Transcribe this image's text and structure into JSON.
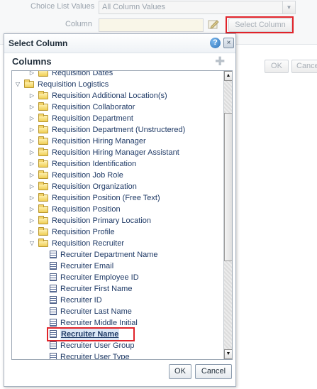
{
  "background": {
    "choice_list_label": "Choice List Values",
    "choice_list_value": "All Column Values",
    "column_label": "Column",
    "select_column_button": "Select Column",
    "ok_button": "OK",
    "cancel_button": "Cance"
  },
  "dialog": {
    "title": "Select Column",
    "help_icon": "?",
    "close_icon": "×",
    "columns_header": "Columns",
    "tree": [
      {
        "label": "Requisition Dates",
        "kind": "folder",
        "level": 1,
        "expanded": false
      },
      {
        "label": "Requisition Logistics",
        "kind": "folder",
        "level": 0,
        "expanded": true
      },
      {
        "label": "Requisition Additional Location(s)",
        "kind": "folder",
        "level": 1,
        "expanded": false
      },
      {
        "label": "Requisition Collaborator",
        "kind": "folder",
        "level": 1,
        "expanded": false
      },
      {
        "label": "Requisition Department",
        "kind": "folder",
        "level": 1,
        "expanded": false
      },
      {
        "label": "Requisition Department (Unstructered)",
        "kind": "folder",
        "level": 1,
        "expanded": false
      },
      {
        "label": "Requisition Hiring Manager",
        "kind": "folder",
        "level": 1,
        "expanded": false
      },
      {
        "label": "Requisition Hiring Manager Assistant",
        "kind": "folder",
        "level": 1,
        "expanded": false
      },
      {
        "label": "Requisition Identification",
        "kind": "folder",
        "level": 1,
        "expanded": false
      },
      {
        "label": "Requisition Job Role",
        "kind": "folder",
        "level": 1,
        "expanded": false
      },
      {
        "label": "Requisition Organization",
        "kind": "folder",
        "level": 1,
        "expanded": false
      },
      {
        "label": "Requisition Position (Free Text)",
        "kind": "folder",
        "level": 1,
        "expanded": false
      },
      {
        "label": "Requisition Position",
        "kind": "folder",
        "level": 1,
        "expanded": false
      },
      {
        "label": "Requisition Primary Location",
        "kind": "folder",
        "level": 1,
        "expanded": false
      },
      {
        "label": "Requisition Profile",
        "kind": "folder",
        "level": 1,
        "expanded": false
      },
      {
        "label": "Requisition Recruiter",
        "kind": "folder",
        "level": 1,
        "expanded": true
      },
      {
        "label": "Recruiter Department Name",
        "kind": "column",
        "level": 2
      },
      {
        "label": "Recruiter Email",
        "kind": "column",
        "level": 2
      },
      {
        "label": "Recruiter Employee ID",
        "kind": "column",
        "level": 2
      },
      {
        "label": "Recruiter First Name",
        "kind": "column",
        "level": 2
      },
      {
        "label": "Recruiter ID",
        "kind": "column",
        "level": 2
      },
      {
        "label": "Recruiter Last Name",
        "kind": "column",
        "level": 2
      },
      {
        "label": "Recruiter Middle Initial",
        "kind": "column",
        "level": 2
      },
      {
        "label": "Recruiter Name",
        "kind": "column",
        "level": 2,
        "selected": true
      },
      {
        "label": "Recruiter User Group",
        "kind": "column",
        "level": 2
      },
      {
        "label": "Recruiter User Type",
        "kind": "column",
        "level": 2
      }
    ],
    "ok_button": "OK",
    "cancel_button": "Cancel"
  },
  "colors": {
    "highlight_border": "#e0232a",
    "tree_text": "#1f3a66",
    "selection_bg": "#dbe7f6"
  }
}
